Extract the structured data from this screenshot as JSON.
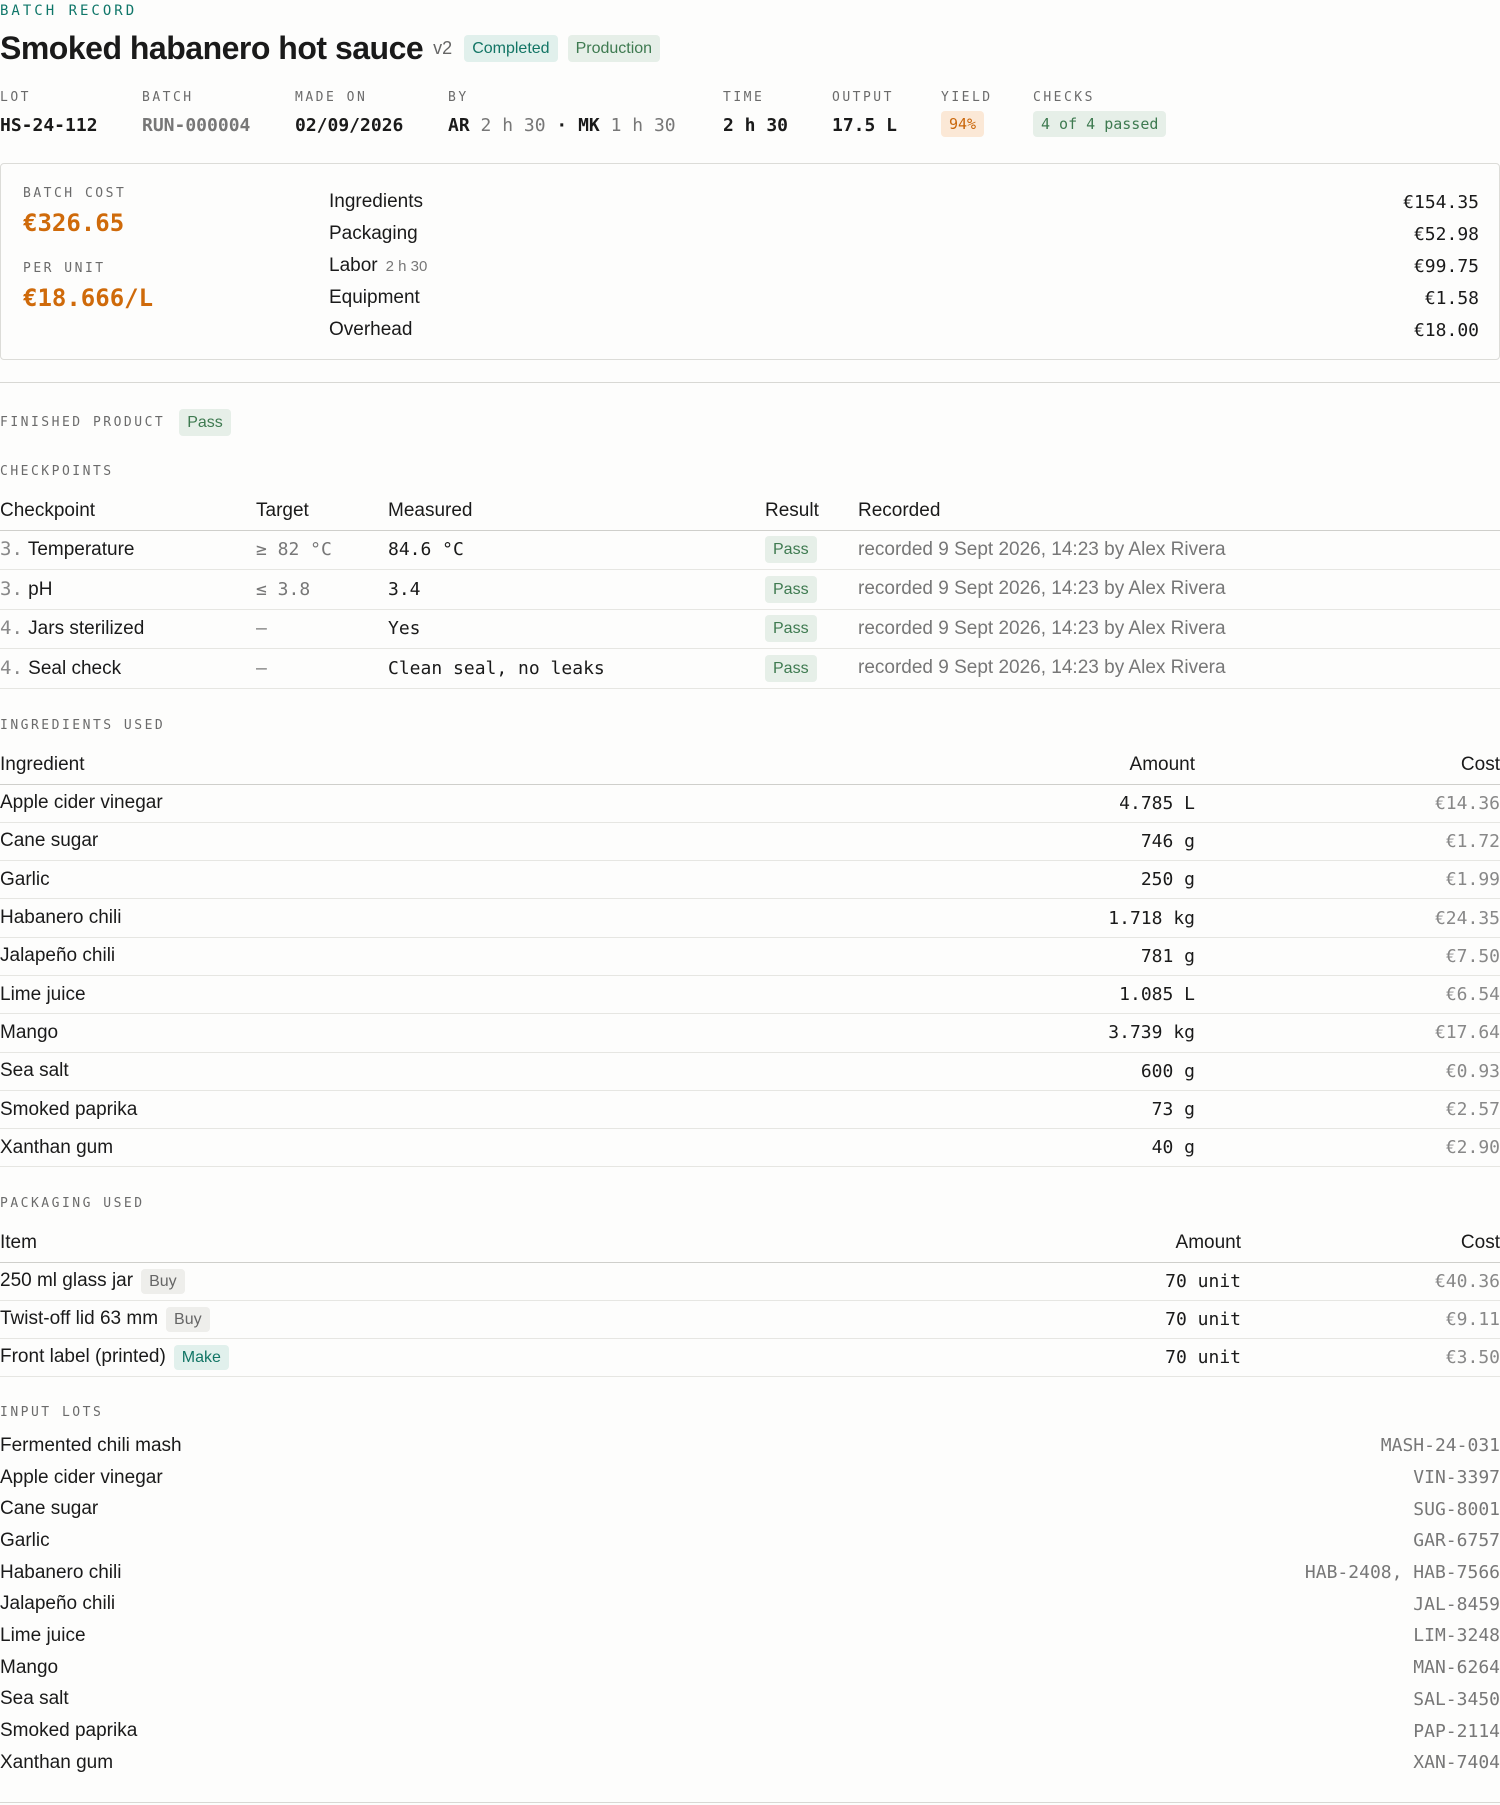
{
  "header": {
    "eyebrow": "BATCH RECORD",
    "title": "Smoked habanero hot sauce",
    "version": "v2",
    "status_badge": "Completed",
    "mode_badge": "Production"
  },
  "meta": {
    "lot_label": "LOT",
    "lot": "HS-24-112",
    "batch_label": "BATCH",
    "batch": "RUN-000004",
    "made_on_label": "MADE ON",
    "made_on": "02/09/2026",
    "by_label": "BY",
    "by": [
      {
        "initials": "AR",
        "time": "2 h 30"
      },
      {
        "initials": "MK",
        "time": "1 h 30"
      }
    ],
    "by_separator": "·",
    "time_label": "TIME",
    "time": "2 h 30",
    "output_label": "OUTPUT",
    "output": "17.5 L",
    "yield_label": "YIELD",
    "yield": "94%",
    "checks_label": "CHECKS",
    "checks": "4 of 4 passed"
  },
  "cost": {
    "batch_cost_label": "BATCH COST",
    "batch_cost": "€326.65",
    "per_unit_label": "PER UNIT",
    "per_unit": "€18.666/L",
    "lines": [
      {
        "label": "Ingredients",
        "sub": "",
        "amount": "€154.35"
      },
      {
        "label": "Packaging",
        "sub": "",
        "amount": "€52.98"
      },
      {
        "label": "Labor",
        "sub": "2 h 30",
        "amount": "€99.75"
      },
      {
        "label": "Equipment",
        "sub": "",
        "amount": "€1.58"
      },
      {
        "label": "Overhead",
        "sub": "",
        "amount": "€18.00"
      }
    ]
  },
  "finished_product": {
    "label": "FINISHED PRODUCT",
    "result": "Pass"
  },
  "checkpoints": {
    "label": "CHECKPOINTS",
    "columns": [
      "Checkpoint",
      "Target",
      "Measured",
      "Result",
      "Recorded"
    ],
    "rows": [
      {
        "num": "3.",
        "name": "Temperature",
        "target": "≥ 82 °C",
        "measured": "84.6 °C",
        "result": "Pass",
        "recorded": "recorded 9 Sept 2026, 14:23 by Alex Rivera"
      },
      {
        "num": "3.",
        "name": "pH",
        "target": "≤ 3.8",
        "measured": "3.4",
        "result": "Pass",
        "recorded": "recorded 9 Sept 2026, 14:23 by Alex Rivera"
      },
      {
        "num": "4.",
        "name": "Jars sterilized",
        "target": "—",
        "measured": "Yes",
        "result": "Pass",
        "recorded": "recorded 9 Sept 2026, 14:23 by Alex Rivera"
      },
      {
        "num": "4.",
        "name": "Seal check",
        "target": "—",
        "measured": "Clean seal, no leaks",
        "result": "Pass",
        "recorded": "recorded 9 Sept 2026, 14:23 by Alex Rivera"
      }
    ]
  },
  "ingredients": {
    "label": "INGREDIENTS USED",
    "columns": [
      "Ingredient",
      "Amount",
      "Cost"
    ],
    "rows": [
      {
        "name": "Apple cider vinegar",
        "amount": "4.785 L",
        "cost": "€14.36"
      },
      {
        "name": "Cane sugar",
        "amount": "746 g",
        "cost": "€1.72"
      },
      {
        "name": "Garlic",
        "amount": "250 g",
        "cost": "€1.99"
      },
      {
        "name": "Habanero chili",
        "amount": "1.718 kg",
        "cost": "€24.35"
      },
      {
        "name": "Jalapeño chili",
        "amount": "781 g",
        "cost": "€7.50"
      },
      {
        "name": "Lime juice",
        "amount": "1.085 L",
        "cost": "€6.54"
      },
      {
        "name": "Mango",
        "amount": "3.739 kg",
        "cost": "€17.64"
      },
      {
        "name": "Sea salt",
        "amount": "600 g",
        "cost": "€0.93"
      },
      {
        "name": "Smoked paprika",
        "amount": "73 g",
        "cost": "€2.57"
      },
      {
        "name": "Xanthan gum",
        "amount": "40 g",
        "cost": "€2.90"
      }
    ]
  },
  "packaging": {
    "label": "PACKAGING USED",
    "columns": [
      "Item",
      "Amount",
      "Cost"
    ],
    "rows": [
      {
        "name": "250 ml glass jar",
        "tag": "Buy",
        "amount": "70 unit",
        "cost": "€40.36"
      },
      {
        "name": "Twist-off lid 63 mm",
        "tag": "Buy",
        "amount": "70 unit",
        "cost": "€9.11"
      },
      {
        "name": "Front label (printed)",
        "tag": "Make",
        "amount": "70 unit",
        "cost": "€3.50"
      }
    ]
  },
  "input_lots": {
    "label": "INPUT LOTS",
    "rows": [
      {
        "name": "Fermented chili mash",
        "codes": "MASH-24-031"
      },
      {
        "name": "Apple cider vinegar",
        "codes": "VIN-3397"
      },
      {
        "name": "Cane sugar",
        "codes": "SUG-8001"
      },
      {
        "name": "Garlic",
        "codes": "GAR-6757"
      },
      {
        "name": "Habanero chili",
        "codes": "HAB-2408, HAB-7566"
      },
      {
        "name": "Jalapeño chili",
        "codes": "JAL-8459"
      },
      {
        "name": "Lime juice",
        "codes": "LIM-3248"
      },
      {
        "name": "Mango",
        "codes": "MAN-6264"
      },
      {
        "name": "Sea salt",
        "codes": "SAL-3450"
      },
      {
        "name": "Smoked paprika",
        "codes": "PAP-2114"
      },
      {
        "name": "Xanthan gum",
        "codes": "XAN-7404"
      }
    ]
  }
}
